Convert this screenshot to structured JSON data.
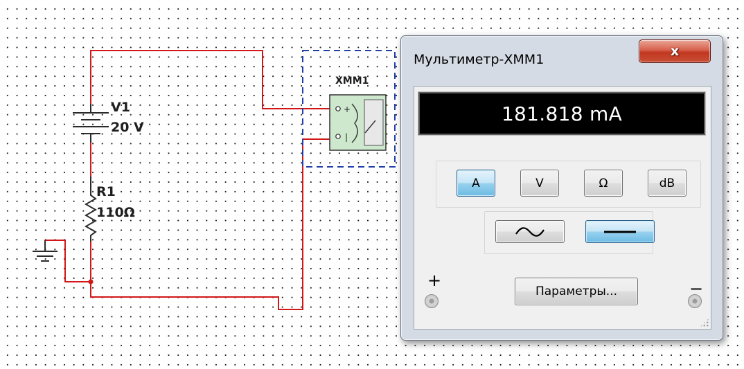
{
  "schematic": {
    "source": {
      "ref": "V1",
      "value": "20 V"
    },
    "resistor": {
      "ref": "R1",
      "value": "110Ω"
    },
    "meter_ref": "XMM1"
  },
  "multimeter": {
    "title": "Мультиметр-XMM1",
    "close_label": "x",
    "reading": "181.818 mA",
    "modes": [
      {
        "label": "A",
        "active": true
      },
      {
        "label": "V",
        "active": false
      },
      {
        "label": "Ω",
        "active": false
      },
      {
        "label": "dB",
        "active": false
      }
    ],
    "coupling": {
      "ac_icon": "sine-wave-icon",
      "dc_icon": "dc-line-icon",
      "active": "dc"
    },
    "params_label": "Параметры...",
    "plus_sign": "+",
    "minus_sign": "−"
  },
  "colors": {
    "wire": "#d11717",
    "meter_box_border": "#1f3fa8",
    "active_button": "#98d1ef",
    "display_bg": "#000000"
  }
}
